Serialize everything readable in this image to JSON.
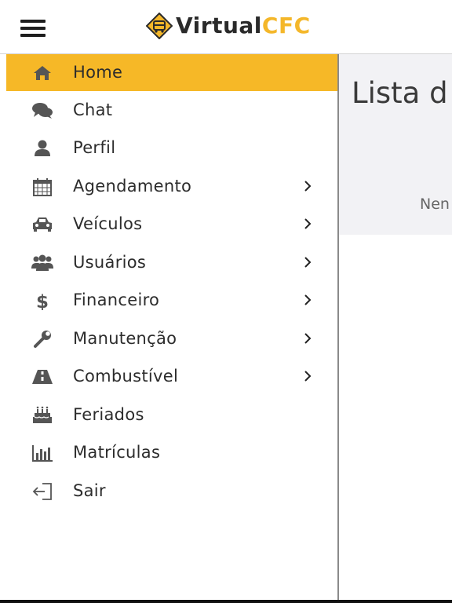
{
  "header": {
    "logo_primary": "Virtual",
    "logo_accent": "CFC",
    "menu_icon": "hamburger-icon",
    "accent_color": "#f6b827"
  },
  "sidebar": {
    "items": [
      {
        "label": "Home",
        "icon": "home-icon",
        "active": true,
        "has_submenu": false
      },
      {
        "label": "Chat",
        "icon": "chat-icon",
        "active": false,
        "has_submenu": false
      },
      {
        "label": "Perfil",
        "icon": "user-icon",
        "active": false,
        "has_submenu": false
      },
      {
        "label": "Agendamento",
        "icon": "calendar-icon",
        "active": false,
        "has_submenu": true
      },
      {
        "label": "Veículos",
        "icon": "car-icon",
        "active": false,
        "has_submenu": true
      },
      {
        "label": "Usuários",
        "icon": "users-icon",
        "active": false,
        "has_submenu": true
      },
      {
        "label": "Financeiro",
        "icon": "dollar-icon",
        "active": false,
        "has_submenu": true
      },
      {
        "label": "Manutenção",
        "icon": "wrench-icon",
        "active": false,
        "has_submenu": true
      },
      {
        "label": "Combustível",
        "icon": "road-icon",
        "active": false,
        "has_submenu": true
      },
      {
        "label": "Feriados",
        "icon": "cake-icon",
        "active": false,
        "has_submenu": false
      },
      {
        "label": "Matrículas",
        "icon": "bar-chart-icon",
        "active": false,
        "has_submenu": false
      },
      {
        "label": "Sair",
        "icon": "sign-out-icon",
        "active": false,
        "has_submenu": false
      }
    ]
  },
  "content": {
    "title": "Lista d",
    "note": "Nen"
  }
}
